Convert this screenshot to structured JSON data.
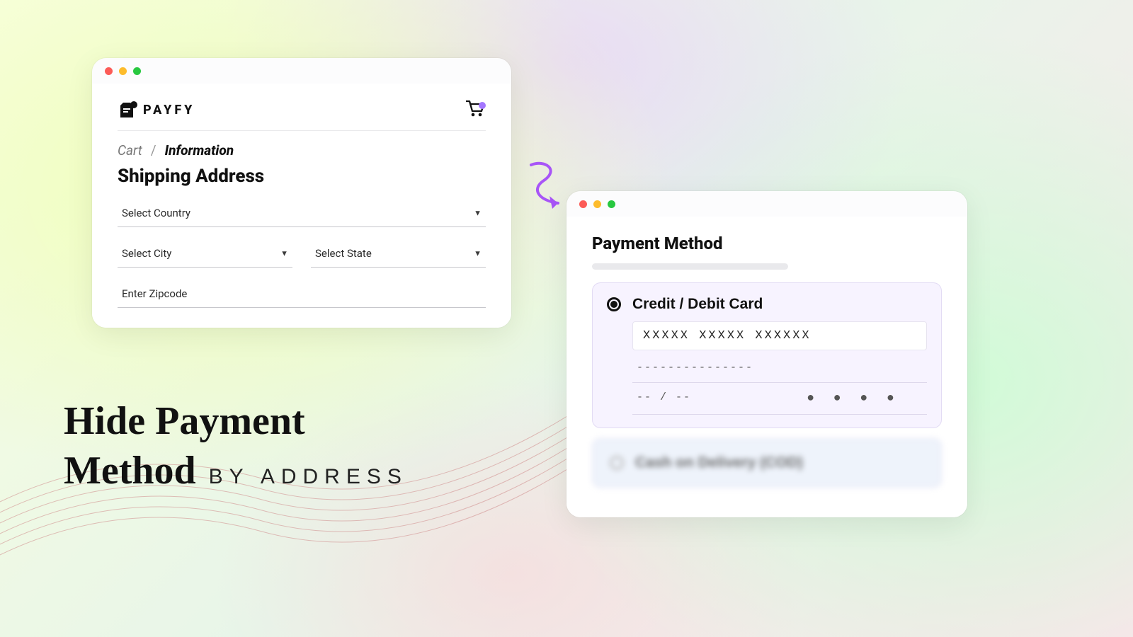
{
  "brand": {
    "name": "PAYFY"
  },
  "breadcrumb": {
    "past": "Cart",
    "sep": "/",
    "current": "Information"
  },
  "shipping": {
    "title": "Shipping Address",
    "country": "Select Country",
    "city": "Select City",
    "state": "Select State",
    "zipcode": "Enter Zipcode"
  },
  "payment": {
    "title": "Payment Method",
    "card": {
      "label": "Credit / Debit Card",
      "number": "XXXXX XXXXX XXXXXX",
      "name": "---------------",
      "exp": "-- / --",
      "cvv": "● ● ● ●"
    },
    "cod": {
      "label": "Cash on Delivery (COD)"
    }
  },
  "headline": {
    "l1a": "Hide Payment",
    "l1b": "Method",
    "sub": "BY ADDRESS"
  }
}
